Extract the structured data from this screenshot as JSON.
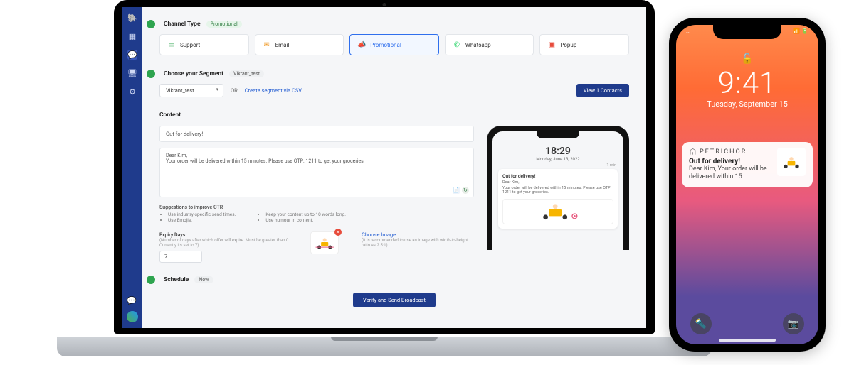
{
  "sidebar": {},
  "channel": {
    "section_title": "Channel Type",
    "pill": "Promotional",
    "items": [
      {
        "label": "Support",
        "icon": "💬",
        "color": "#2ea44f"
      },
      {
        "label": "Email",
        "icon": "✉️",
        "color": "#f1a fallback"
      },
      {
        "label": "Promotional",
        "icon": "📣",
        "color": "#2f6fed"
      },
      {
        "label": "Whatsapp",
        "icon": "🟢",
        "color": "#25d366"
      },
      {
        "label": "Popup",
        "icon": "🔳",
        "color": "#e74c3c"
      }
    ]
  },
  "segment": {
    "section_title": "Choose your Segment",
    "pill": "Vikrant_test",
    "select_value": "Vikrant_test",
    "or": "OR",
    "create_link": "Create segment via CSV",
    "view_button": "View 1 Contacts"
  },
  "content": {
    "section_title": "Content",
    "subject": "Out for delivery!",
    "body_greeting": "Dear Kim,",
    "body_text": "Your order will be delivered within 15 minutes. Please use OTP: 1211 to get your groceries.",
    "suggestions_title": "Suggestions to improve CTR",
    "suggestions_left": [
      "Use industry-specific send times.",
      "Use Emojis."
    ],
    "suggestions_right": [
      "Keep your content up to 10 words long.",
      "Use humour in content."
    ],
    "expiry_label": "Expiry Days",
    "expiry_hint": "(Number of days after which offer will expire. Must be greater than 0. Currently its set to 7)",
    "expiry_value": "7",
    "choose_image": "Choose Image",
    "choose_image_hint": "(It is recommended to use an image with width-to-height ratio as 2.5:1)"
  },
  "preview": {
    "time": "18:29",
    "date": "Monday, June 13, 2022",
    "badge_time": "1 min",
    "title": "Out for delivery!",
    "line1": "Dear Kim,",
    "line2": "Your order will be delivered within 15 minutes. Please use OTP: 1211 to get your groceries."
  },
  "schedule": {
    "section_title": "Schedule",
    "pill": "Now"
  },
  "submit": {
    "label": "Verify and Send Broadcast"
  },
  "iphone": {
    "status_left": "...",
    "status_right": "📶 🔋",
    "time": "9:41",
    "date": "Tuesday, September 15",
    "notif_app": "PETRICHOR",
    "notif_title": "Out for delivery!",
    "notif_body": "Dear Kim, Your order will be delivered within 15 ..."
  }
}
